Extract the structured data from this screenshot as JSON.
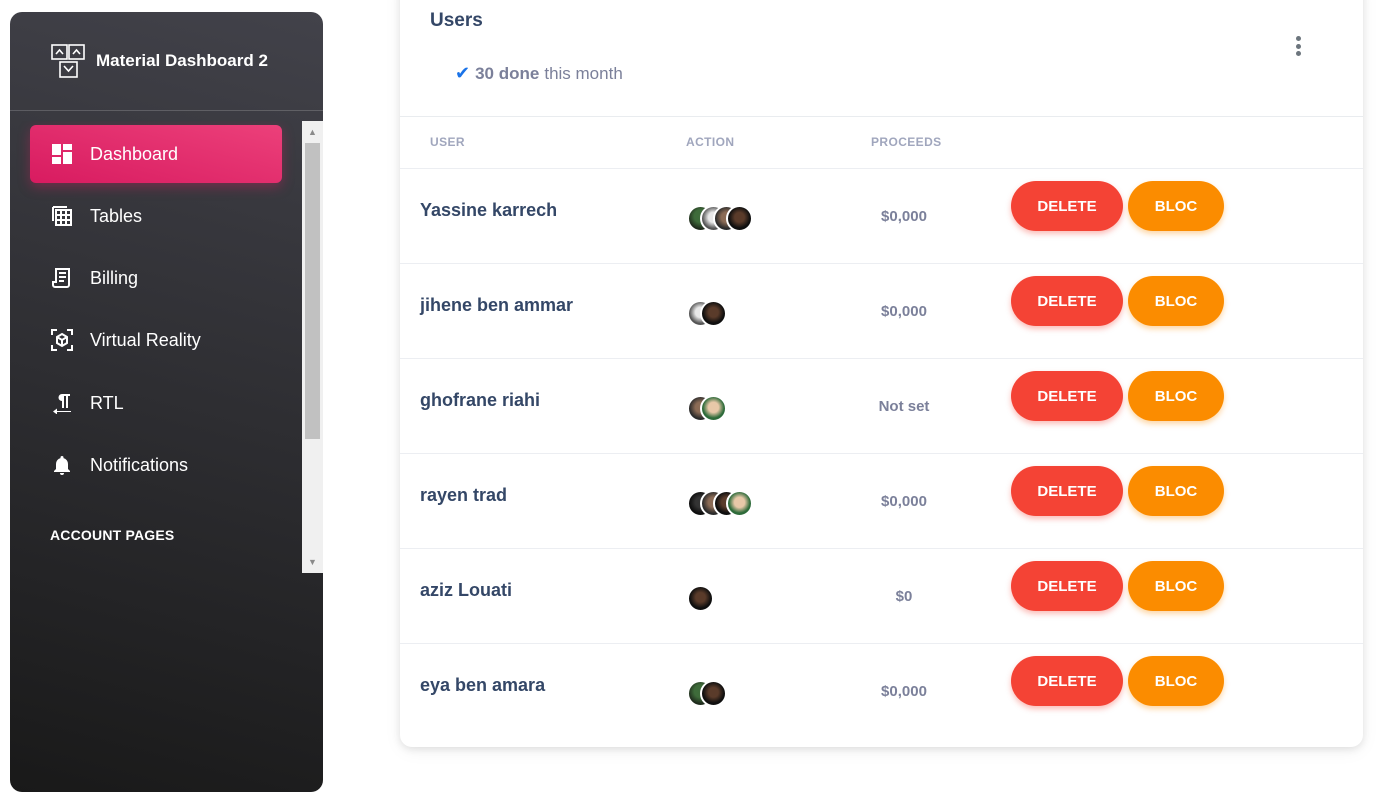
{
  "sidebar": {
    "brand": "Material Dashboard 2",
    "items": [
      {
        "label": "Dashboard",
        "icon": "dashboard-icon",
        "active": true
      },
      {
        "label": "Tables",
        "icon": "table-view-icon"
      },
      {
        "label": "Billing",
        "icon": "receipt-icon"
      },
      {
        "label": "Virtual Reality",
        "icon": "view-in-ar-icon"
      },
      {
        "label": "RTL",
        "icon": "format-textdirection-icon"
      },
      {
        "label": "Notifications",
        "icon": "notifications-icon"
      }
    ],
    "section_label": "ACCOUNT PAGES"
  },
  "card": {
    "title": "Users",
    "subtitle_bold": "30 done",
    "subtitle_rest": "this month"
  },
  "table": {
    "headers": {
      "user": "USER",
      "action": "ACTION",
      "proceeds": "PROCEEDS"
    },
    "delete_label": "DELETE",
    "bloc_label": "BLOC",
    "rows": [
      {
        "name": "Yassine karrech",
        "proceeds": "$0,000"
      },
      {
        "name": "jihene ben ammar",
        "proceeds": "$0,000"
      },
      {
        "name": "ghofrane riahi",
        "proceeds": "Not set"
      },
      {
        "name": "rayen trad",
        "proceeds": "$0,000"
      },
      {
        "name": "aziz Louati",
        "proceeds": "$0"
      },
      {
        "name": "eya ben amara",
        "proceeds": "$0,000"
      }
    ]
  },
  "colors": {
    "sidebar_top": "#42424a",
    "sidebar_bottom": "#191919",
    "active_pink": "#E91E63",
    "delete_red": "#F44335",
    "bloc_orange": "#FB8C00",
    "check_blue": "#1A73E8",
    "text_dark": "#344767",
    "text_muted": "#7b809a"
  }
}
